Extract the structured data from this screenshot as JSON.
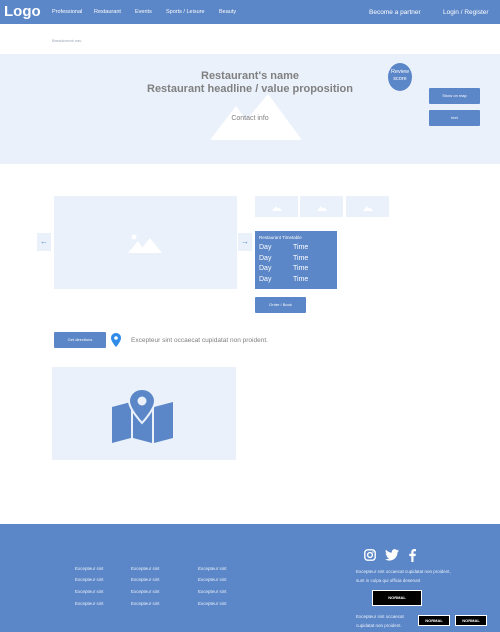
{
  "nav": {
    "logo": "Logo",
    "links": [
      "Professional",
      "Restaurant",
      "Events",
      "Sports / Leisure",
      "Beauty"
    ],
    "partner": "Become a partner",
    "login": "Login / Register"
  },
  "breadcrumb": "Breadcrumb nav",
  "hero": {
    "name": "Restaurant's name",
    "headline": "Restaurant headline / value proposition",
    "contact": "Contact info",
    "review": [
      "Review",
      "score"
    ],
    "show_map_button": "Show on map",
    "text_button": "text"
  },
  "timetable": {
    "title": "Restaurant Timetable",
    "rows": [
      {
        "day": "Day",
        "time": "Time"
      },
      {
        "day": "Day",
        "time": "Time"
      },
      {
        "day": "Day",
        "time": "Time"
      },
      {
        "day": "Day",
        "time": "Time"
      }
    ]
  },
  "order_button": "Order / Book",
  "directions": {
    "button": "Get directions",
    "text": "Excepteur sint occaecat cupidatat non proident."
  },
  "footer": {
    "columns": [
      [
        "Excepteur sint",
        "Excepteur sint",
        "Excepteur sint",
        "Excepteur sint"
      ],
      [
        "Excepteur sint",
        "Excepteur sint",
        "Excepteur sint",
        "Excepteur sint"
      ],
      [
        "Excepteur sint",
        "Excepteur sint",
        "Excepteur sint",
        "Excepteur sint"
      ]
    ],
    "social": [
      "instagram-icon",
      "twitter-icon",
      "facebook-icon"
    ],
    "paragraph1": "Excepteur sint occaecat cupidatat non proident, sunt in culpa qui officia deserunt",
    "normal_button": "NORMAL",
    "paragraph2": "Excepteur sint occaecat cupidatat non proident.",
    "small_buttons": [
      "NORMAL",
      "NORMAL"
    ]
  },
  "colors": {
    "primary": "#5b86c7",
    "light": "#eaf1fb",
    "text_gray": "#808080"
  }
}
